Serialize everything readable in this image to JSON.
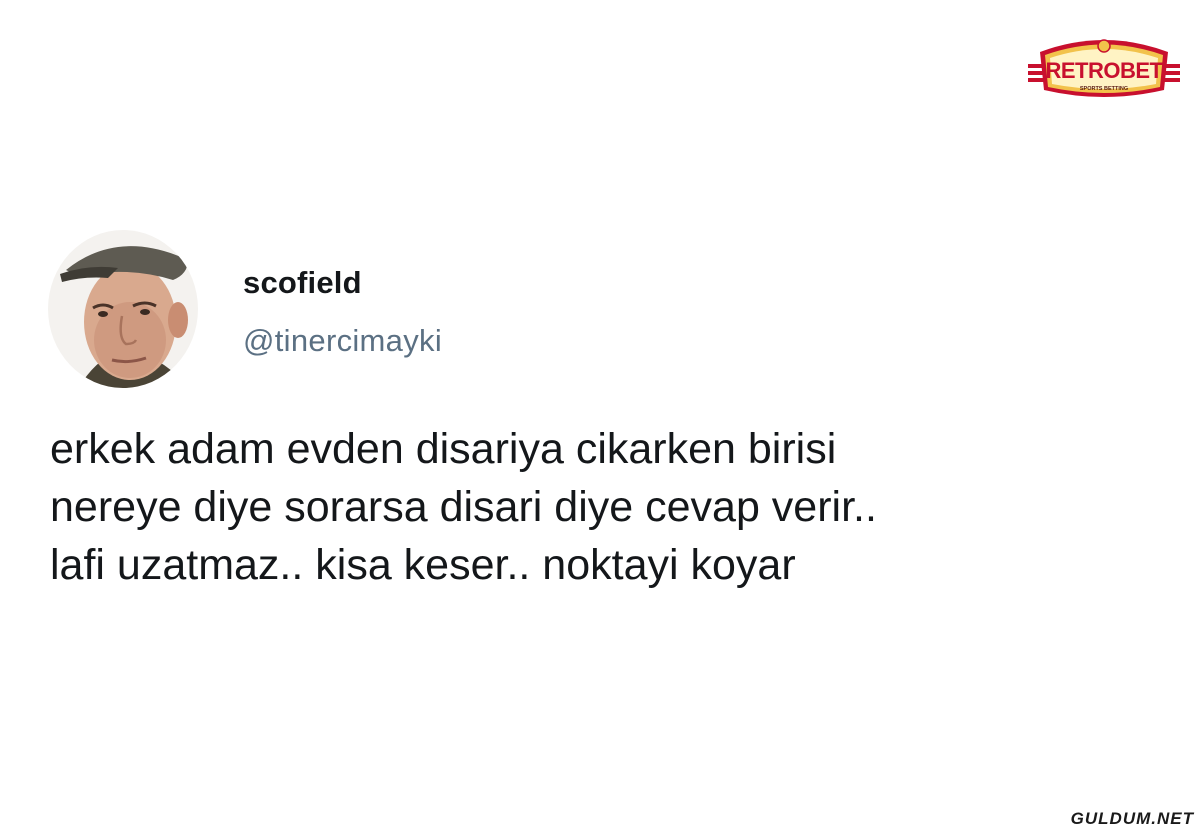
{
  "logo": {
    "brand": "RETROBET",
    "tagline": "SPORTS BETTING",
    "colors": {
      "red": "#c8102e",
      "gold": "#f2c24b",
      "cream": "#fff3c4"
    }
  },
  "author": {
    "display_name": "scofield",
    "handle": "@tinercimayki",
    "avatar_icon": "avatar-photo"
  },
  "tweet": {
    "lines": [
      "erkek adam evden disariya cikarken birisi",
      "nereye diye sorarsa disari diye cevap verir..",
      "lafi uzatmaz.. kisa keser.. noktayi koyar"
    ]
  },
  "watermark": "GULDUM.NET",
  "colors": {
    "text": "#14171a",
    "secondary": "#5b7083",
    "background": "#ffffff"
  }
}
